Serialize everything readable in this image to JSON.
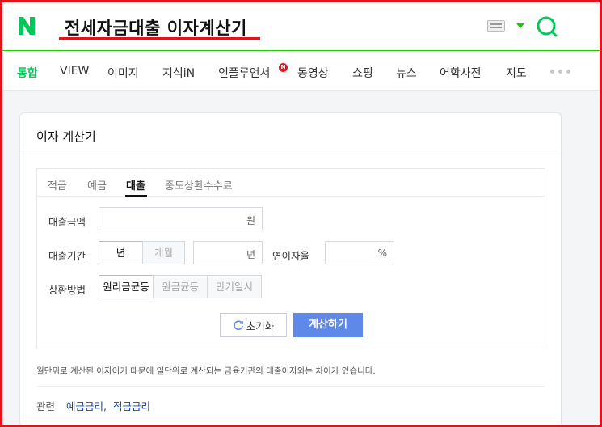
{
  "header": {
    "logo": "N",
    "query": "전세자금대출 이자계산기",
    "brand_color": "#03c75a"
  },
  "tabs": [
    {
      "label": "통합",
      "active": true
    },
    {
      "label": "VIEW"
    },
    {
      "label": "이미지"
    },
    {
      "label": "지식iN"
    },
    {
      "label": "인플루언서"
    },
    {
      "label": "동영상"
    },
    {
      "label": "쇼핑"
    },
    {
      "label": "뉴스"
    },
    {
      "label": "어학사전"
    },
    {
      "label": "지도"
    }
  ],
  "influencer_badge": "N",
  "card": {
    "title": "이자 계산기",
    "calc_tabs": [
      "적금",
      "예금",
      "대출",
      "중도상환수수료"
    ],
    "active_calc_tab": "대출",
    "loan_amount": {
      "label": "대출금액",
      "unit": "원",
      "value": ""
    },
    "loan_period": {
      "label": "대출기간",
      "options": [
        "년",
        "개월"
      ],
      "selected": "년",
      "unit": "년",
      "value": ""
    },
    "interest_rate": {
      "label": "연이자율",
      "unit": "%",
      "value": ""
    },
    "repayment": {
      "label": "상환방법",
      "options": [
        "원리금균등",
        "원금균등",
        "만기일시"
      ],
      "selected": "원리금균등"
    },
    "reset_button": "초기화",
    "calc_button": "계산하기",
    "notice": "월단위로 계산된 이자이기 때문에 일단위로 계산되는 금융기관의 대출이자와는 차이가 있습니다.",
    "related": {
      "label": "관련",
      "links": [
        "예금금리",
        "적금금리"
      ]
    }
  },
  "colors": {
    "accent": "#03c75a",
    "highlight": "#e0141e",
    "calc_button": "#5f89e8"
  }
}
